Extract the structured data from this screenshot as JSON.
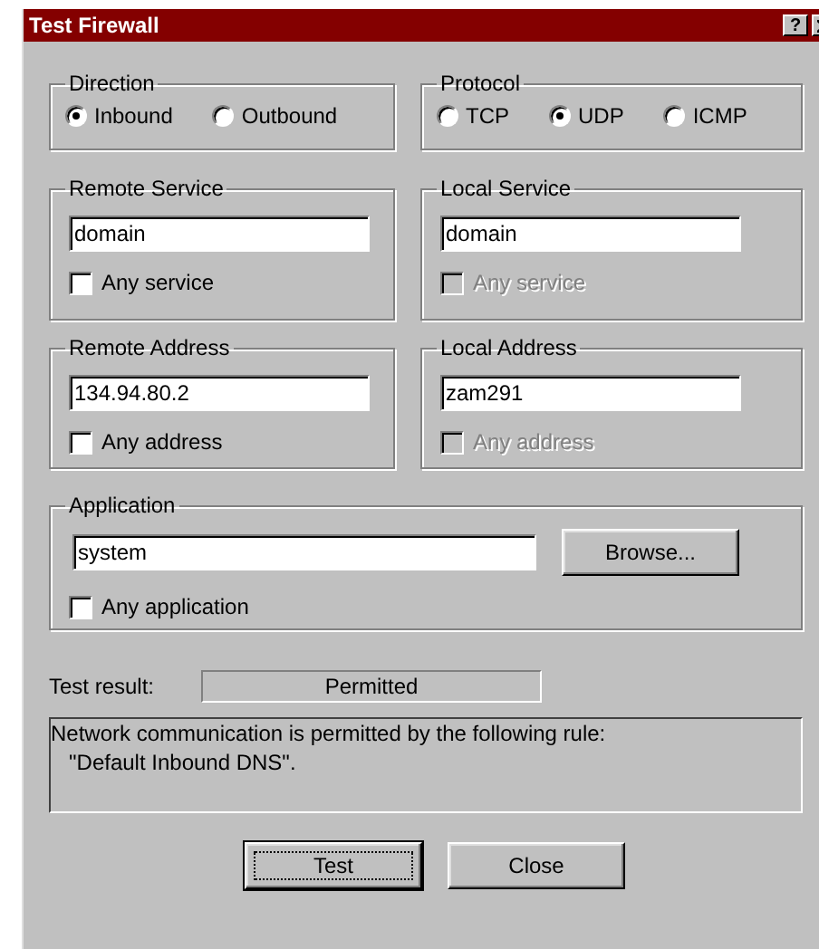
{
  "window": {
    "title": "Test Firewall",
    "help_button": "?"
  },
  "direction": {
    "label": "Direction",
    "options": [
      {
        "label": "Inbound",
        "selected": true
      },
      {
        "label": "Outbound",
        "selected": false
      }
    ]
  },
  "protocol": {
    "label": "Protocol",
    "options": [
      {
        "label": "TCP",
        "selected": false
      },
      {
        "label": "UDP",
        "selected": true
      },
      {
        "label": "ICMP",
        "selected": false
      }
    ]
  },
  "remote_service": {
    "label": "Remote Service",
    "value": "domain",
    "checkbox": {
      "label": "Any service",
      "checked": false,
      "disabled": false
    }
  },
  "local_service": {
    "label": "Local Service",
    "value": "domain",
    "checkbox": {
      "label": "Any service",
      "checked": false,
      "disabled": true
    }
  },
  "remote_address": {
    "label": "Remote Address",
    "value": "134.94.80.2",
    "checkbox": {
      "label": "Any address",
      "checked": false,
      "disabled": false
    }
  },
  "local_address": {
    "label": "Local Address",
    "value": "zam291",
    "checkbox": {
      "label": "Any address",
      "checked": false,
      "disabled": true
    }
  },
  "application": {
    "label": "Application",
    "value": "system",
    "browse_button": "Browse...",
    "checkbox": {
      "label": "Any application",
      "checked": false,
      "disabled": false
    }
  },
  "test_result": {
    "label": "Test result:",
    "value": "Permitted"
  },
  "message": "Network communication is permitted by the following rule:\n   \"Default Inbound DNS\".",
  "buttons": [
    {
      "label": "Test",
      "default": true
    },
    {
      "label": "Close",
      "default": false
    }
  ]
}
